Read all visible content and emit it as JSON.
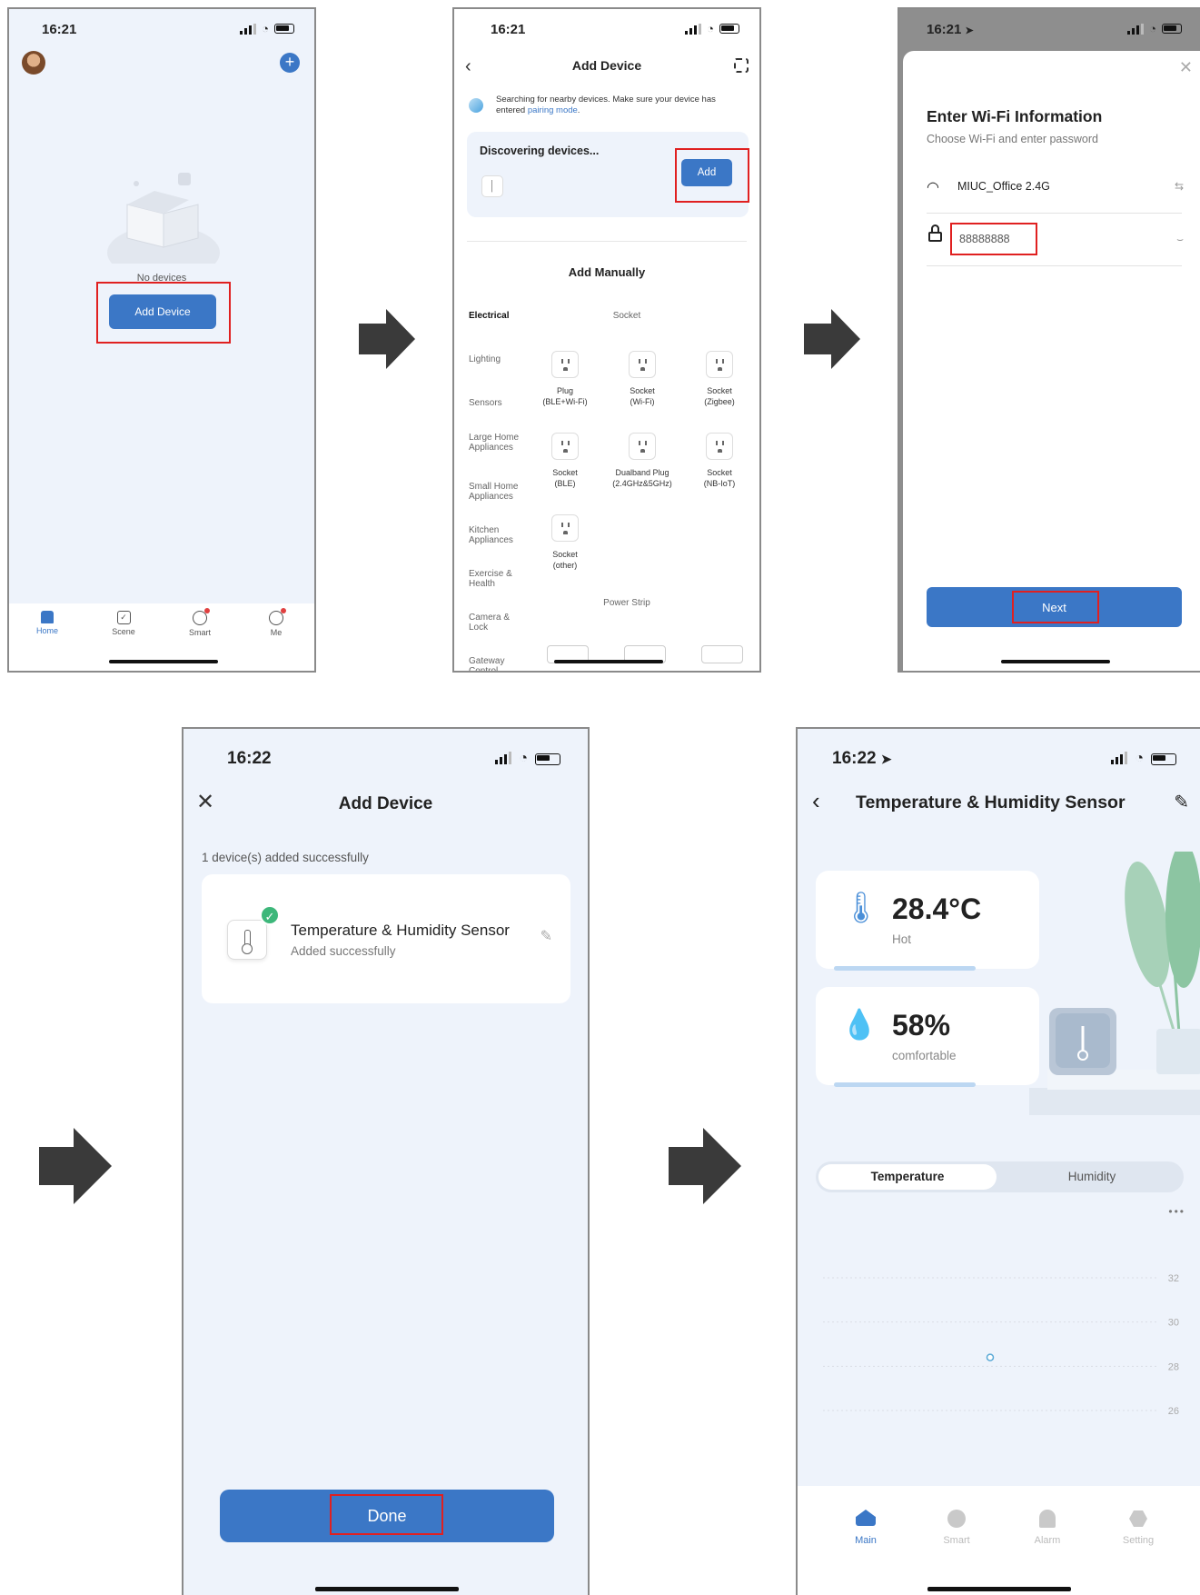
{
  "screen1": {
    "time": "16:21",
    "empty_text": "No devices",
    "add_button": "Add Device",
    "tabs": [
      {
        "label": "Home",
        "icon": "home-icon"
      },
      {
        "label": "Scene",
        "icon": "scene-icon"
      },
      {
        "label": "Smart",
        "icon": "smart-icon"
      },
      {
        "label": "Me",
        "icon": "me-icon"
      }
    ]
  },
  "screen2": {
    "time": "16:21",
    "title": "Add Device",
    "search_text": "Searching for nearby devices. Make sure your device has entered ",
    "search_link": "pairing mode",
    "search_end": ".",
    "discovering": "Discovering devices...",
    "add_button": "Add",
    "manual_title": "Add Manually",
    "categories": [
      "Electrical",
      "Lighting",
      "Sensors",
      "Large Home Appliances",
      "Small Home Appliances",
      "Kitchen Appliances",
      "Exercise & Health",
      "Camera & Lock",
      "Gateway Control"
    ],
    "section_socket": "Socket",
    "section_power": "Power Strip",
    "products": [
      {
        "line1": "Plug",
        "line2": "(BLE+Wi-Fi)"
      },
      {
        "line1": "Socket",
        "line2": "(Wi-Fi)"
      },
      {
        "line1": "Socket",
        "line2": "(Zigbee)"
      },
      {
        "line1": "Socket",
        "line2": "(BLE)"
      },
      {
        "line1": "Dualband Plug",
        "line2": "(2.4GHz&5GHz)"
      },
      {
        "line1": "Socket",
        "line2": "(NB-IoT)"
      },
      {
        "line1": "Socket",
        "line2": "(other)"
      }
    ]
  },
  "screen3": {
    "time": "16:21",
    "title": "Enter Wi-Fi Information",
    "subtitle": "Choose Wi-Fi and enter password",
    "ssid": "MIUC_Office 2.4G",
    "password": "88888888",
    "next_button": "Next"
  },
  "screen4": {
    "time": "16:22",
    "title": "Add Device",
    "success_count": "1 device(s) added successfully",
    "device_name": "Temperature & Humidity Sensor",
    "device_status": "Added successfully",
    "done_button": "Done"
  },
  "screen5": {
    "time": "16:22",
    "title": "Temperature & Humidity Sensor",
    "temperature": "28.4°C",
    "temp_state": "Hot",
    "humidity": "58%",
    "hum_state": "comfortable",
    "seg_temperature": "Temperature",
    "seg_humidity": "Humidity",
    "more": "•••",
    "tabs": [
      {
        "label": "Main",
        "icon": "home-icon"
      },
      {
        "label": "Smart",
        "icon": "clock-icon"
      },
      {
        "label": "Alarm",
        "icon": "bell-icon"
      },
      {
        "label": "Setting",
        "icon": "gear-icon"
      }
    ]
  },
  "chart_data": {
    "type": "line",
    "y_ticks": [
      32,
      30,
      28,
      26
    ],
    "points": [
      {
        "y": 28.4
      }
    ],
    "ylim": [
      25,
      33
    ],
    "grid": true
  }
}
